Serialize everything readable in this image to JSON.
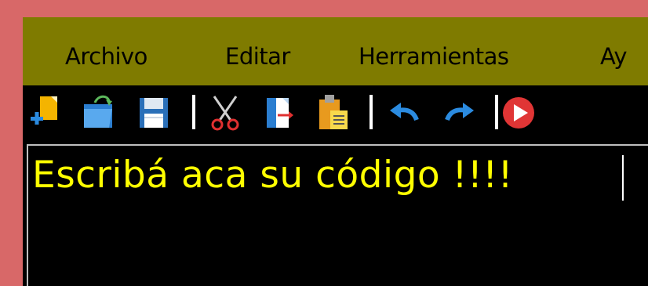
{
  "menu": {
    "items": [
      {
        "label": "Archivo"
      },
      {
        "label": "Editar"
      },
      {
        "label": "Herramientas"
      },
      {
        "label": "Ay"
      }
    ]
  },
  "toolbar": {
    "buttons": [
      {
        "icon": "new-file-icon"
      },
      {
        "icon": "open-folder-icon"
      },
      {
        "icon": "save-icon"
      },
      {
        "icon": "cut-icon"
      },
      {
        "icon": "copy-icon"
      },
      {
        "icon": "paste-icon"
      },
      {
        "icon": "undo-icon"
      },
      {
        "icon": "redo-icon"
      },
      {
        "icon": "run-icon"
      }
    ]
  },
  "editor": {
    "content": "Escribá aca su código !!!!"
  },
  "colors": {
    "background": "#d86868",
    "menubar": "#7f7b00",
    "editor_text": "#ffff00",
    "editor_bg": "#000000"
  }
}
